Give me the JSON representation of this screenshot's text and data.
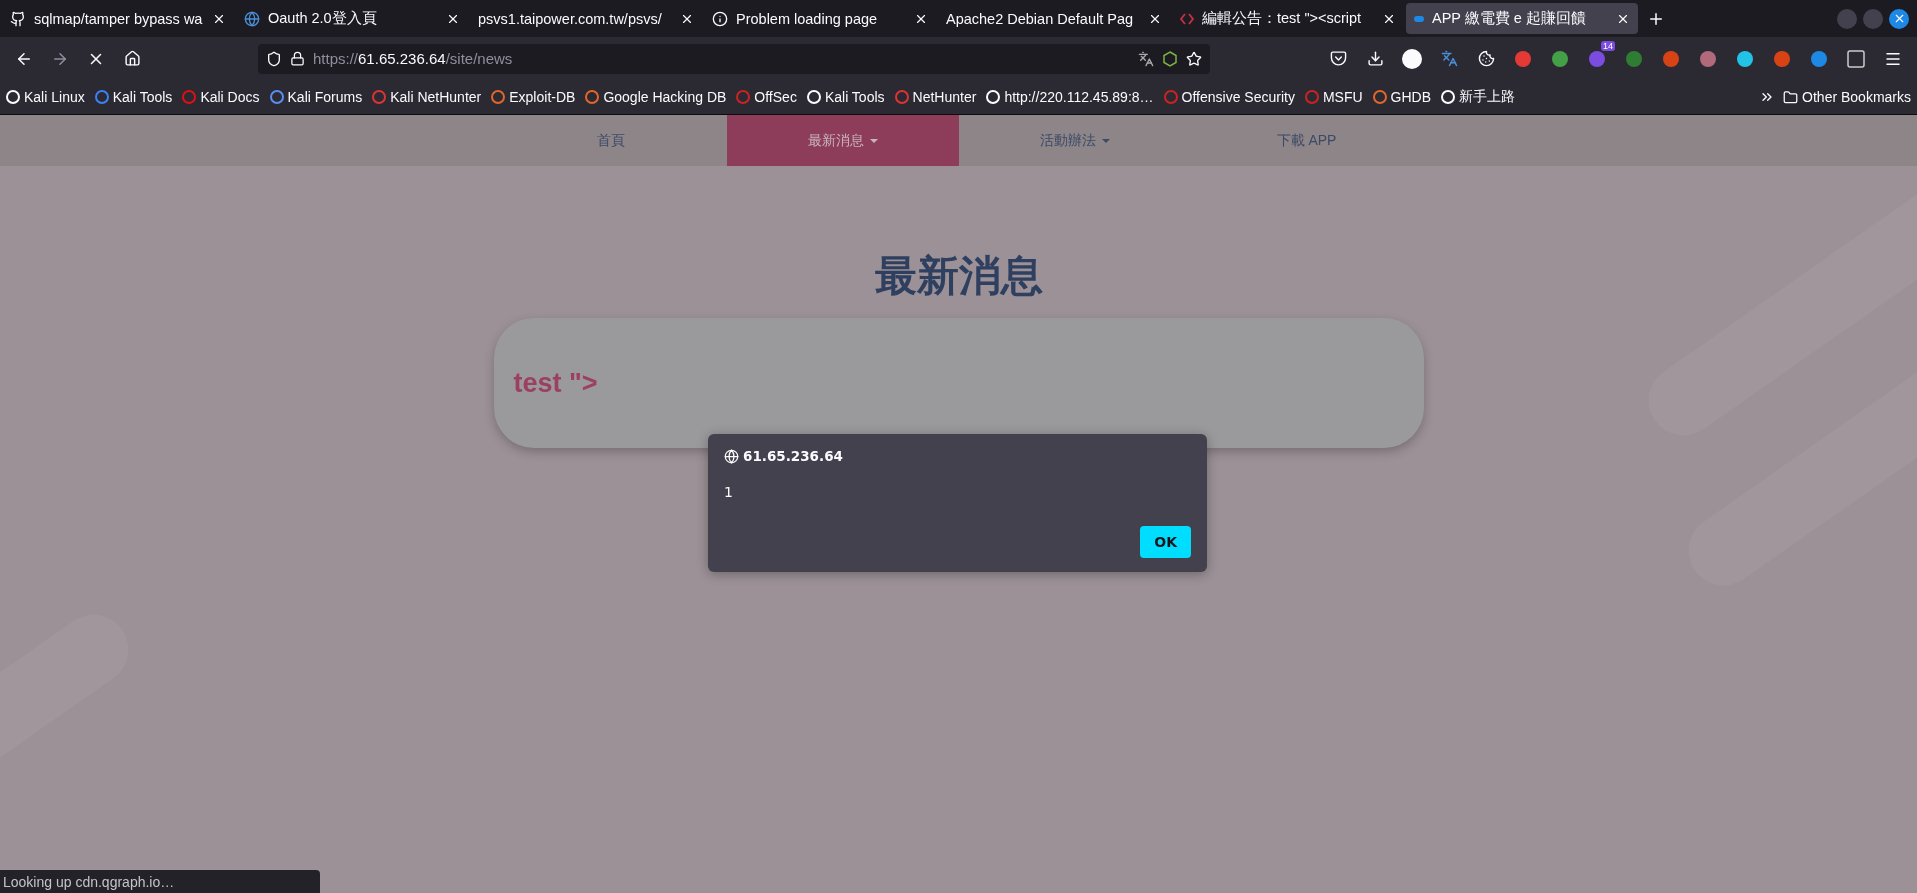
{
  "browser": {
    "tabs": [
      {
        "title": "sqlmap/tamper bypass wa",
        "selected": false
      },
      {
        "title": "Oauth 2.0登入頁",
        "selected": false
      },
      {
        "title": "psvs1.taipower.com.tw/psvs/",
        "selected": false
      },
      {
        "title": "Problem loading page",
        "selected": false
      },
      {
        "title": "Apache2 Debian Default Pag",
        "selected": false
      },
      {
        "title": "編輯公告：test \"><script",
        "selected": false
      },
      {
        "title": "APP 繳電費 e 起賺回饋",
        "selected": true
      }
    ],
    "loading": true,
    "url": {
      "scheme": "https://",
      "host": "61.65.236.64",
      "path": "/site/news"
    },
    "extension_badge": "14",
    "bookmarks": [
      "Kali Linux",
      "Kali Tools",
      "Kali Docs",
      "Kali Forums",
      "Kali NetHunter",
      "Exploit-DB",
      "Google Hacking DB",
      "OffSec",
      "Kali Tools",
      "NetHunter",
      "http://220.112.45.89:8…",
      "Offensive Security",
      "MSFU",
      "GHDB",
      "新手上路"
    ],
    "other_bookmarks": "Other Bookmarks",
    "status": "Looking up cdn.qgraph.io…"
  },
  "page": {
    "nav": [
      {
        "label": "首頁",
        "selected": false,
        "dropdown": false
      },
      {
        "label": "最新消息",
        "selected": true,
        "dropdown": true
      },
      {
        "label": "活動辦法",
        "selected": false,
        "dropdown": true
      },
      {
        "label": "下載 APP",
        "selected": false,
        "dropdown": false
      }
    ],
    "heading": "最新消息",
    "card_title": "test \">"
  },
  "dialog": {
    "origin": "61.65.236.64",
    "message": "1",
    "button": "OK"
  }
}
